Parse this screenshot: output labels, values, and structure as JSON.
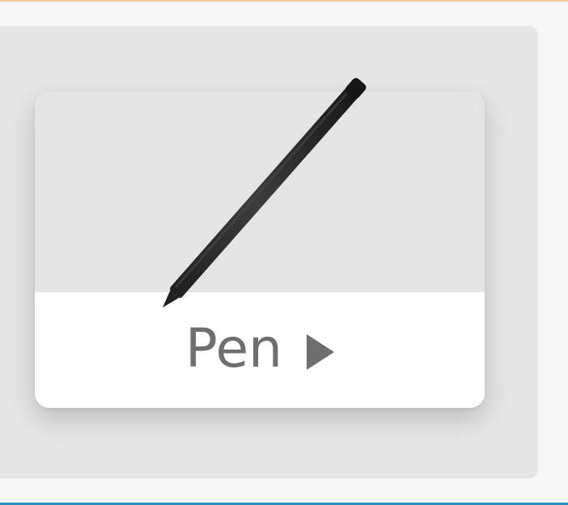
{
  "card": {
    "label": "Pen",
    "arrow_icon": "play-triangle-icon",
    "image_icon": "pen-icon"
  },
  "colors": {
    "page_background": "#f6f6f6",
    "panel_background": "#e6e6e6",
    "card_image_background": "#e4e4e4",
    "card_footer_background": "#ffffff",
    "label_color": "#6e6e6e",
    "pen_color": "#2a2a2a",
    "top_accent": "#f4c79c",
    "bottom_accent": "#2b8fbf"
  }
}
